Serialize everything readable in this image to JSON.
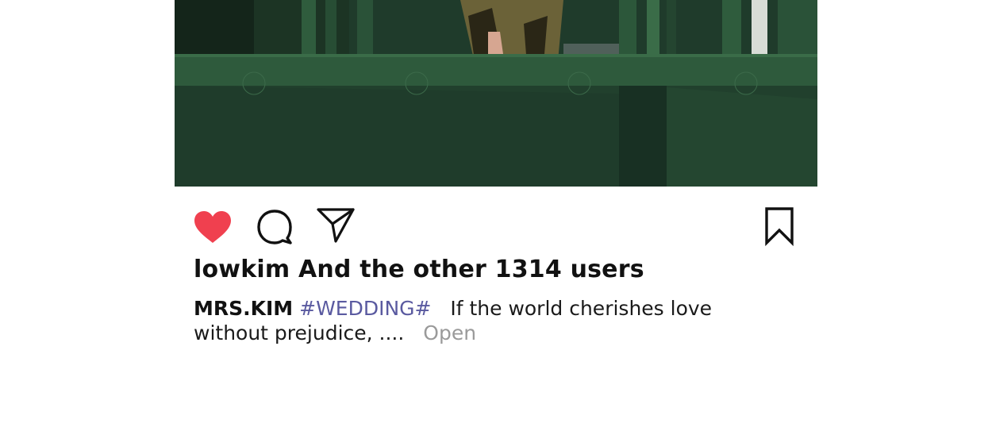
{
  "post": {
    "image": {
      "description_icon": "photo-icon",
      "colors": {
        "dark_green": "#1f3b2b",
        "mid_green": "#2e5a3c",
        "light_green": "#3c7048",
        "gold": "#6b6238"
      }
    },
    "actions": {
      "like_icon": "heart-filled-icon",
      "like_color": "#f0404f",
      "comment_icon": "comment-icon",
      "share_icon": "send-icon",
      "save_icon": "bookmark-icon"
    },
    "likes": {
      "text": "lowkim And the other 1314 users"
    },
    "caption": {
      "username": "MRS.KIM",
      "hashtag": "#WEDDING#",
      "text": "If the world cherishes love without prejudice, ....",
      "more_label": "Open"
    },
    "colors": {
      "hashtag": "#5a5aa0",
      "more": "#9a9a9a",
      "text": "#111111"
    }
  }
}
